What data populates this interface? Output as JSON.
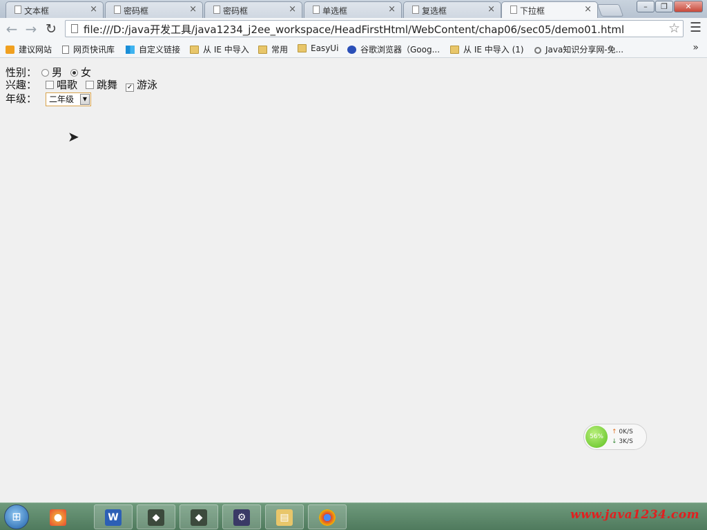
{
  "browser": {
    "tabs": [
      {
        "title": "文本框",
        "active": false
      },
      {
        "title": "密码框",
        "active": false
      },
      {
        "title": "密码框",
        "active": false
      },
      {
        "title": "单选框",
        "active": false
      },
      {
        "title": "复选框",
        "active": false
      },
      {
        "title": "下拉框",
        "active": true
      }
    ],
    "tab_close_glyph": "×",
    "url": "file:///D:/java开发工具/java1234_j2ee_workspace/HeadFirstHtml/WebContent/chap06/sec05/demo01.html",
    "icons": {
      "back": "back-arrow-icon",
      "forward": "forward-arrow-icon",
      "reload": "reload-icon",
      "star": "bookmark-star-icon",
      "menu": "menu-icon"
    }
  },
  "bookmarks": [
    {
      "label": "建议网站",
      "icon": "bulb"
    },
    {
      "label": "网页快讯库",
      "icon": "page"
    },
    {
      "label": "自定义链接",
      "icon": "windows"
    },
    {
      "label": "从 IE 中导入",
      "icon": "folder"
    },
    {
      "label": "常用",
      "icon": "folder"
    },
    {
      "label": "EasyUi",
      "icon": "folder"
    },
    {
      "label": "谷歌浏览器（Goog...",
      "icon": "paw"
    },
    {
      "label": "从 IE 中导入 (1)",
      "icon": "folder"
    },
    {
      "label": "Java知识分享网-免...",
      "icon": "search"
    }
  ],
  "bookmarks_more": "»",
  "form": {
    "gender": {
      "label": "性别：",
      "options": [
        {
          "label": "男",
          "checked": false
        },
        {
          "label": "女",
          "checked": true
        }
      ]
    },
    "hobby": {
      "label": "兴趣：",
      "options": [
        {
          "label": "唱歌",
          "checked": false
        },
        {
          "label": "跳舞",
          "checked": false
        },
        {
          "label": "游泳",
          "checked": true
        }
      ]
    },
    "grade": {
      "label": "年级：",
      "selected": "二年级"
    }
  },
  "net_widget": {
    "percent": "56%",
    "up": "0K/S",
    "down": "3K/S"
  },
  "taskbar": {
    "watermark": "www.java1234.com"
  },
  "colors": {
    "select_border": "#d8a24a",
    "watermark": "#e02020",
    "net_ball": "#5cbf1f"
  }
}
